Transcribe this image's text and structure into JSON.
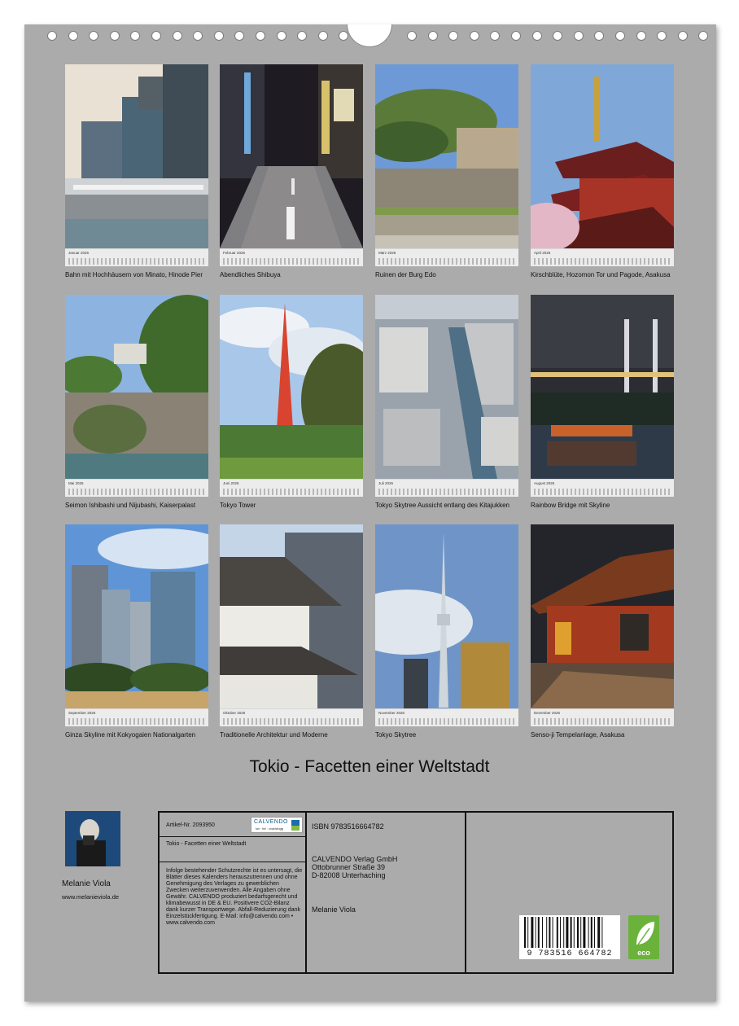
{
  "months": [
    {
      "month": "Januar 2026",
      "caption": "Bahn mit Hochhäusern von Minato, Hinode Pier"
    },
    {
      "month": "Februar 2026",
      "caption": "Abendliches Shibuya"
    },
    {
      "month": "März 2026",
      "caption": "Ruinen der Burg Edo"
    },
    {
      "month": "April 2026",
      "caption": "Kirschblüte, Hozomon Tor und Pagode, Asakusa"
    },
    {
      "month": "Mai 2026",
      "caption": "Seimon Ishibashi und Nijubashi, Kaiserpalast"
    },
    {
      "month": "Juni 2026",
      "caption": "Tokyo Tower"
    },
    {
      "month": "Juli 2026",
      "caption": "Tokyo Skytree Aussicht entlang des Kitajukken"
    },
    {
      "month": "August 2026",
      "caption": "Rainbow Bridge mit Skyline"
    },
    {
      "month": "September 2026",
      "caption": "Ginza Skyline mit Kokyogaien Nationalgarten"
    },
    {
      "month": "Oktober 2026",
      "caption": "Traditionelle Architektur und Moderne"
    },
    {
      "month": "November 2026",
      "caption": "Tokyo Skytree"
    },
    {
      "month": "Dezember 2026",
      "caption": "Senso-ji Tempelanlage, Asakusa"
    }
  ],
  "title": "Tokio - Facetten einer Weltstadt",
  "author": {
    "name": "Melanie Viola",
    "website": "www.melanieviola.de"
  },
  "info": {
    "artikel": "Artikel-Nr. 2093950",
    "calvendo_logo": "CALVENDO",
    "calvendo_tagline": "fair · frei · unabhängig",
    "calendar_title": "Tokio - Facetten einer Weltstadt",
    "legal": "Infolge bestehender Schutzrechte ist es untersagt, die Blätter dieses Kalenders herauszutrennen und ohne Genehmigung des Verlages zu gewerblichen Zwecken weiterzuverwenden. Alle Angaben ohne Gewähr. CALVENDO produziert bedarfsgerecht und klimabewusst in DE & EU. Positivere CO2-Bilanz dank kurzer Transportwege. Abfall-Reduzierung dank Einzelstückfertigung. E-Mail: info@calvendo.com • www.calvendo.com",
    "isbn": "ISBN 9783516664782",
    "publisher_line1": "CALVENDO Verlag GmbH",
    "publisher_line2": "Ottobrunner Straße 39",
    "publisher_line3": "D-82008 Unterhaching",
    "author": "Melanie Viola",
    "barcode_digits": "9 783516 664782",
    "eco_label": "eco"
  }
}
